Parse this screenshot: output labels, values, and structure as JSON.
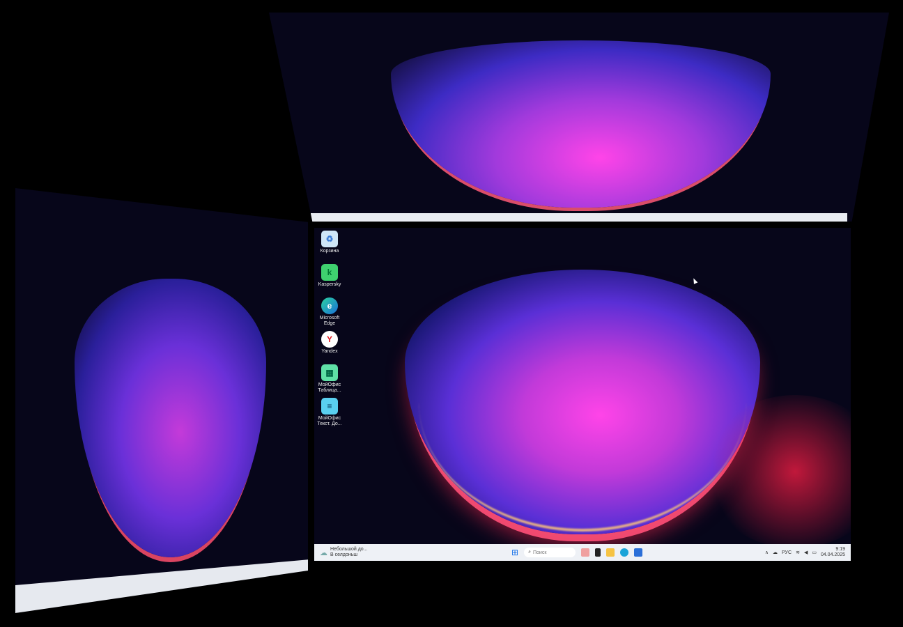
{
  "desktop_icons": [
    {
      "name": "Корзина",
      "icon": "recycle-bin-icon"
    },
    {
      "name": "Kaspersky",
      "icon": "kaspersky-icon"
    },
    {
      "name": "Microsoft Edge",
      "icon": "edge-icon"
    },
    {
      "name": "Yandex",
      "icon": "yandex-icon"
    },
    {
      "name": "МойОфис Таблица...",
      "icon": "myoffice-table-icon"
    },
    {
      "name": "МойОфис Текст. До...",
      "icon": "myoffice-text-icon"
    }
  ],
  "taskbar": {
    "weather_line1": "Небольшой до...",
    "weather_line2": "В селдоньш",
    "search_placeholder": "Поиск",
    "language": "РУС",
    "time": "9:19",
    "date": "04.04.2025"
  },
  "colors": {
    "wallpaper_bg": "#07061a",
    "taskbar": "#eef1f6",
    "accent": "#ff44e8"
  }
}
